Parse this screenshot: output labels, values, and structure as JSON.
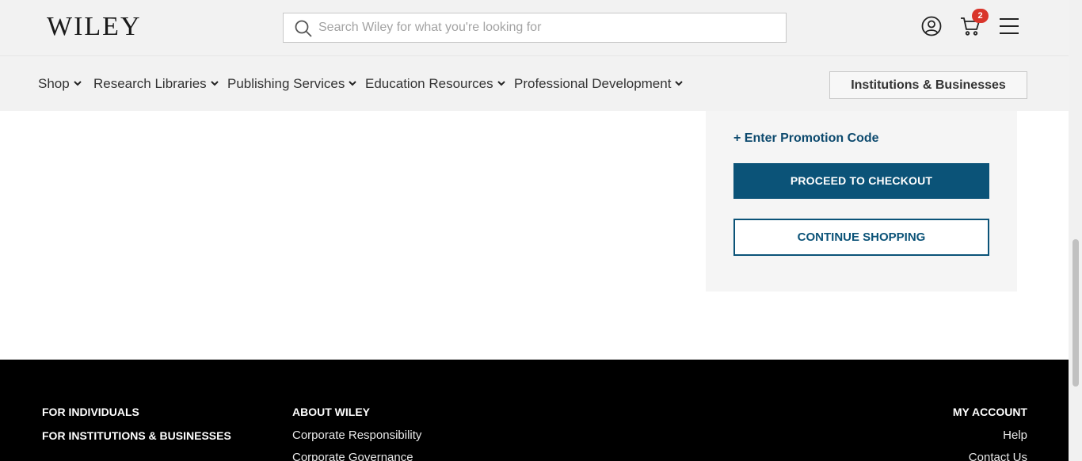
{
  "header": {
    "logo_text": "WILEY",
    "search_placeholder": "Search Wiley for what you're looking for",
    "cart_count": "2",
    "icons": {
      "search": "search-icon",
      "account": "account-icon",
      "cart": "cart-icon",
      "menu": "menu-icon"
    }
  },
  "nav": {
    "items": [
      {
        "label": "Shop"
      },
      {
        "label": "Research Libraries"
      },
      {
        "label": "Publishing Services"
      },
      {
        "label": "Education Resources"
      },
      {
        "label": "Professional Development"
      }
    ],
    "institutions_button": "Institutions & Businesses"
  },
  "summary": {
    "promo_link": "+ Enter Promotion Code",
    "checkout_button": "PROCEED TO CHECKOUT",
    "continue_button": "CONTINUE SHOPPING"
  },
  "footer": {
    "col1": {
      "heading1": "FOR INDIVIDUALS",
      "heading2": "FOR INSTITUTIONS & BUSINESSES"
    },
    "col2": {
      "heading": "ABOUT WILEY",
      "links": [
        "Corporate Responsibility",
        "Corporate Governance"
      ]
    },
    "col3": {
      "heading": "MY ACCOUNT",
      "links": [
        "Help",
        "Contact Us"
      ]
    }
  },
  "colors": {
    "brand_blue": "#0b5378",
    "badge_red": "#d9352b",
    "header_bg": "#f2f2f2",
    "footer_bg": "#000000"
  }
}
